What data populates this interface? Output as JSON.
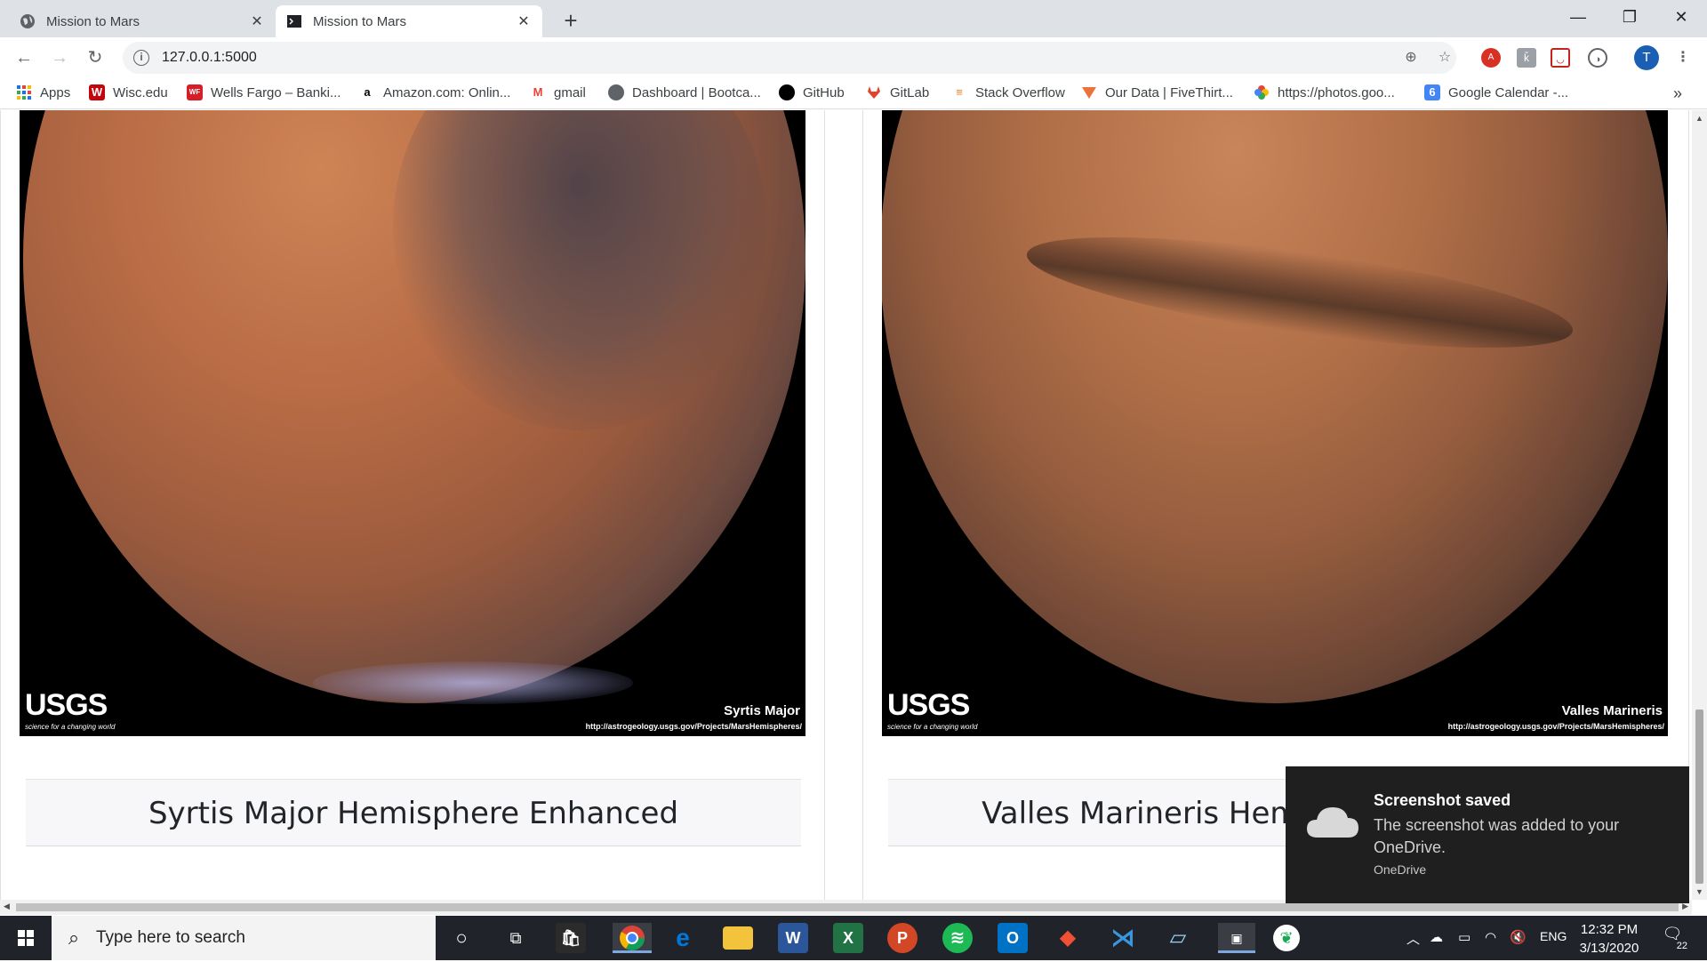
{
  "browser": {
    "tabs": [
      {
        "title": "Mission to Mars",
        "active": false
      },
      {
        "title": "Mission to Mars",
        "active": true
      }
    ],
    "url": "127.0.0.1:5000",
    "bookmarks": [
      {
        "label": "Apps",
        "icon": "apps-grid-icon",
        "color": "#1a73e8"
      },
      {
        "label": "Wisc.edu",
        "icon": "wisc-icon",
        "color": "#c5050c"
      },
      {
        "label": "Wells Fargo – Banki...",
        "icon": "wells-fargo-icon",
        "color": "#d71e28"
      },
      {
        "label": "Amazon.com: Onlin...",
        "icon": "amazon-icon",
        "color": "#000000"
      },
      {
        "label": "gmail",
        "icon": "gmail-icon",
        "color": "#ea4335"
      },
      {
        "label": "Dashboard | Bootca...",
        "icon": "globe-icon",
        "color": "#5f6368"
      },
      {
        "label": "GitHub",
        "icon": "github-icon",
        "color": "#000000"
      },
      {
        "label": "GitLab",
        "icon": "gitlab-icon",
        "color": "#e24329"
      },
      {
        "label": "Stack Overflow",
        "icon": "stackoverflow-icon",
        "color": "#f48024"
      },
      {
        "label": "Our Data | FiveThirt...",
        "icon": "fivethirtyeight-icon",
        "color": "#ed713a"
      },
      {
        "label": "https://photos.goo...",
        "icon": "google-photos-icon",
        "color": "#fbbc04"
      },
      {
        "label": "Google Calendar -...",
        "icon": "google-calendar-icon",
        "color": "#4285f4"
      }
    ],
    "profile_initial": "T",
    "more_bookmarks": "»"
  },
  "hemispheres": [
    {
      "title": "Syrtis Major Hemisphere Enhanced",
      "image_label": "Syrtis Major",
      "image_url_text": "http://astrogeology.usgs.gov/Projects/MarsHemispheres/",
      "logo_text": "USGS",
      "logo_tagline": "science for a changing world"
    },
    {
      "title": "Valles Marineris Hemisphere Enhanced",
      "image_label": "Valles Marineris",
      "image_url_text": "http://astrogeology.usgs.gov/Projects/MarsHemispheres/",
      "logo_text": "USGS",
      "logo_tagline": "science for a changing world"
    }
  ],
  "toast": {
    "title": "Screenshot saved",
    "message": "The screenshot was added to your OneDrive.",
    "source": "OneDrive"
  },
  "taskbar": {
    "search_placeholder": "Type here to search",
    "language": "ENG",
    "time": "12:32 PM",
    "date": "3/13/2020",
    "notification_count": "22"
  }
}
